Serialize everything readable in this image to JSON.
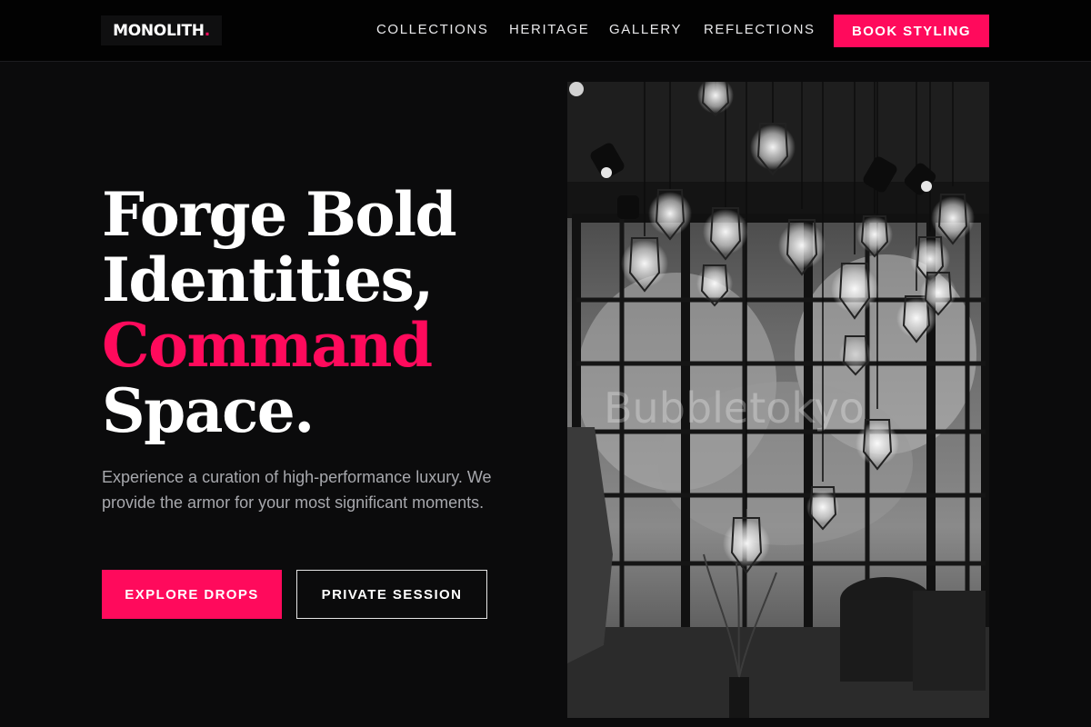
{
  "brand": {
    "name": "MONOLITH",
    "dot": ".",
    "accent_color": "#ff0a5c"
  },
  "nav": {
    "items": [
      {
        "label": "COLLECTIONS"
      },
      {
        "label": "HERITAGE"
      },
      {
        "label": "GALLERY"
      },
      {
        "label": "REFLECTIONS"
      }
    ],
    "cta_label": "BOOK STYLING"
  },
  "hero": {
    "title_line1": "Forge Bold",
    "title_line2": "Identities,",
    "title_accent": "Command",
    "title_line4": "Space.",
    "description": "Experience a curation of high-performance luxury. We provide the armor for your most significant moments.",
    "primary_button": "EXPLORE DROPS",
    "secondary_button": "PRIVATE SESSION",
    "image": {
      "watermark": "Bubbletokyo",
      "subject": "black-and-white interior with hanging cage pendant light bulbs"
    }
  }
}
